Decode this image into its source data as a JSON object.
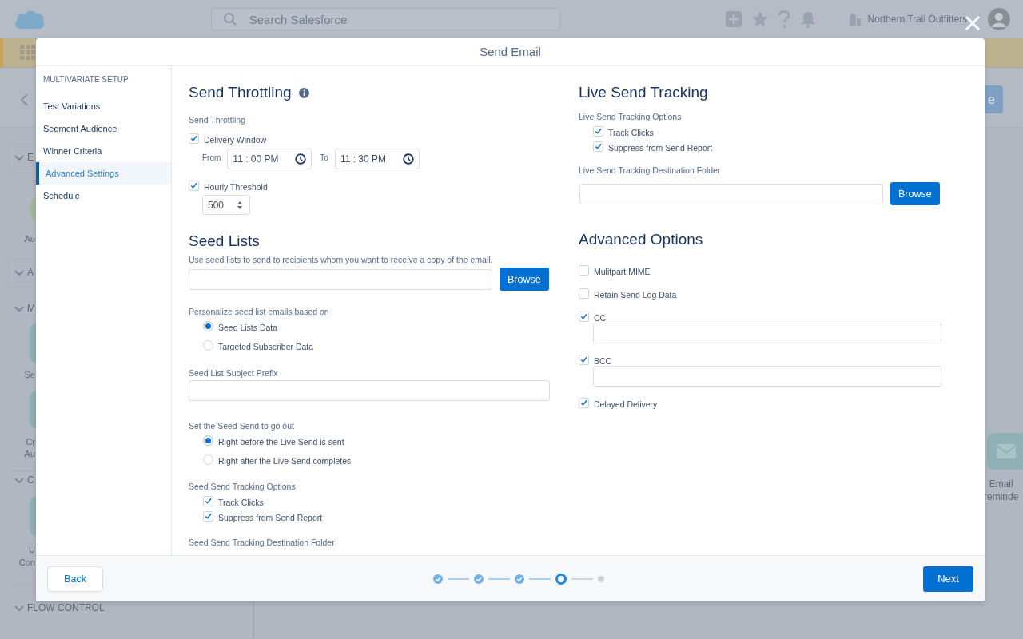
{
  "app_header": {
    "search_placeholder": "Search Salesforce",
    "org_name": "Northern Trail Outfitters"
  },
  "page_header": {
    "button_fragment": "e"
  },
  "builder_panel": {
    "items": [
      {
        "kind": "section-box",
        "label": "E"
      },
      {
        "kind": "circle-tile",
        "lines": [
          "Au"
        ]
      },
      {
        "kind": "section-box",
        "label": "A"
      },
      {
        "kind": "section",
        "label": "M"
      },
      {
        "kind": "tile",
        "lines": [
          "Se"
        ]
      },
      {
        "kind": "tile",
        "lines": [
          "Cr",
          "Au"
        ]
      },
      {
        "kind": "section",
        "label": "C",
        "divider": true
      },
      {
        "kind": "tile",
        "lines": [
          "U",
          "Con"
        ]
      },
      {
        "kind": "section",
        "label": "FLOW CONTROL",
        "divider": true
      }
    ]
  },
  "canvas": {
    "tile": {
      "lines": [
        "Email",
        "reminde"
      ]
    }
  },
  "modal": {
    "title": "Send Email",
    "sidebar": {
      "heading": "MULTIVARIATE SETUP",
      "items": [
        {
          "label": "Test Variations",
          "selected": false
        },
        {
          "label": "Segment Audience",
          "selected": false
        },
        {
          "label": "Winner Criteria",
          "selected": false
        },
        {
          "label": "Advanced Settings",
          "selected": true
        },
        {
          "label": "Schedule",
          "selected": false
        }
      ]
    },
    "left_column": [
      {
        "kind": "heading",
        "text": "Send Throttling",
        "info": true
      },
      {
        "kind": "label",
        "text": "Send Throttling"
      },
      {
        "kind": "checkbox",
        "label": "Delivery Window",
        "checked": true,
        "time_range": {
          "from_label": "From",
          "from": "11 : 00 PM",
          "to_label": "To",
          "to": "11 : 30 PM"
        }
      },
      {
        "kind": "checkbox",
        "label": "Hourly Threshold",
        "checked": true,
        "select": "500"
      },
      {
        "kind": "heading",
        "text": "Seed Lists"
      },
      {
        "kind": "paragraph",
        "text": "Use seed lists to send to recipients whom you want to receive a copy of the email."
      },
      {
        "kind": "file-picker",
        "button": "Browse"
      },
      {
        "kind": "group",
        "label": "Personalize seed list emails based on",
        "options": [
          {
            "kind": "radio",
            "label": "Seed Lists Data",
            "selected": true
          },
          {
            "kind": "radio",
            "label": "Targeted Subscriber Data",
            "selected": false
          }
        ]
      },
      {
        "kind": "text-field",
        "label": "Seed List Subject Prefix"
      },
      {
        "kind": "group",
        "label": "Set the Seed Send to go out",
        "options": [
          {
            "kind": "radio",
            "label": "Right before the Live Send is sent",
            "selected": true
          },
          {
            "kind": "radio",
            "label": "Right after the Live Send completes",
            "selected": false
          }
        ]
      },
      {
        "kind": "group",
        "label": "Seed Send Tracking Options",
        "options": [
          {
            "kind": "checkbox",
            "label": "Track Clicks",
            "checked": true
          },
          {
            "kind": "checkbox",
            "label": "Suppress from Send Report",
            "checked": true
          }
        ]
      },
      {
        "kind": "label",
        "text": "Seed Send Tracking Destination Folder"
      }
    ],
    "right_column": [
      {
        "kind": "heading",
        "text": "Live Send Tracking"
      },
      {
        "kind": "group",
        "label": "Live Send Tracking Options",
        "options": [
          {
            "kind": "checkbox",
            "label": "Track Clicks",
            "checked": true
          },
          {
            "kind": "checkbox",
            "label": "Suppress from Send Report",
            "checked": true
          }
        ]
      },
      {
        "kind": "file-picker",
        "label": "Live Send Tracking Destination Folder",
        "button": "Browse"
      },
      {
        "kind": "heading",
        "text": "Advanced Options"
      },
      {
        "kind": "checkbox",
        "label": "Mulitpart MIME",
        "checked": false
      },
      {
        "kind": "checkbox",
        "label": "Retain Send Log Data",
        "checked": false
      },
      {
        "kind": "checkbox",
        "label": "CC",
        "checked": true,
        "field": true
      },
      {
        "kind": "checkbox",
        "label": "BCC",
        "checked": true,
        "field": true
      },
      {
        "kind": "checkbox",
        "label": "Delayed Delivery",
        "checked": true
      }
    ],
    "footer": {
      "back": "Back",
      "next": "Next",
      "steps": [
        {
          "completed": true,
          "current": false
        },
        {
          "completed": true,
          "current": false
        },
        {
          "completed": true,
          "current": false
        },
        {
          "completed": false,
          "current": true
        },
        {
          "completed": false,
          "current": false
        }
      ]
    }
  }
}
